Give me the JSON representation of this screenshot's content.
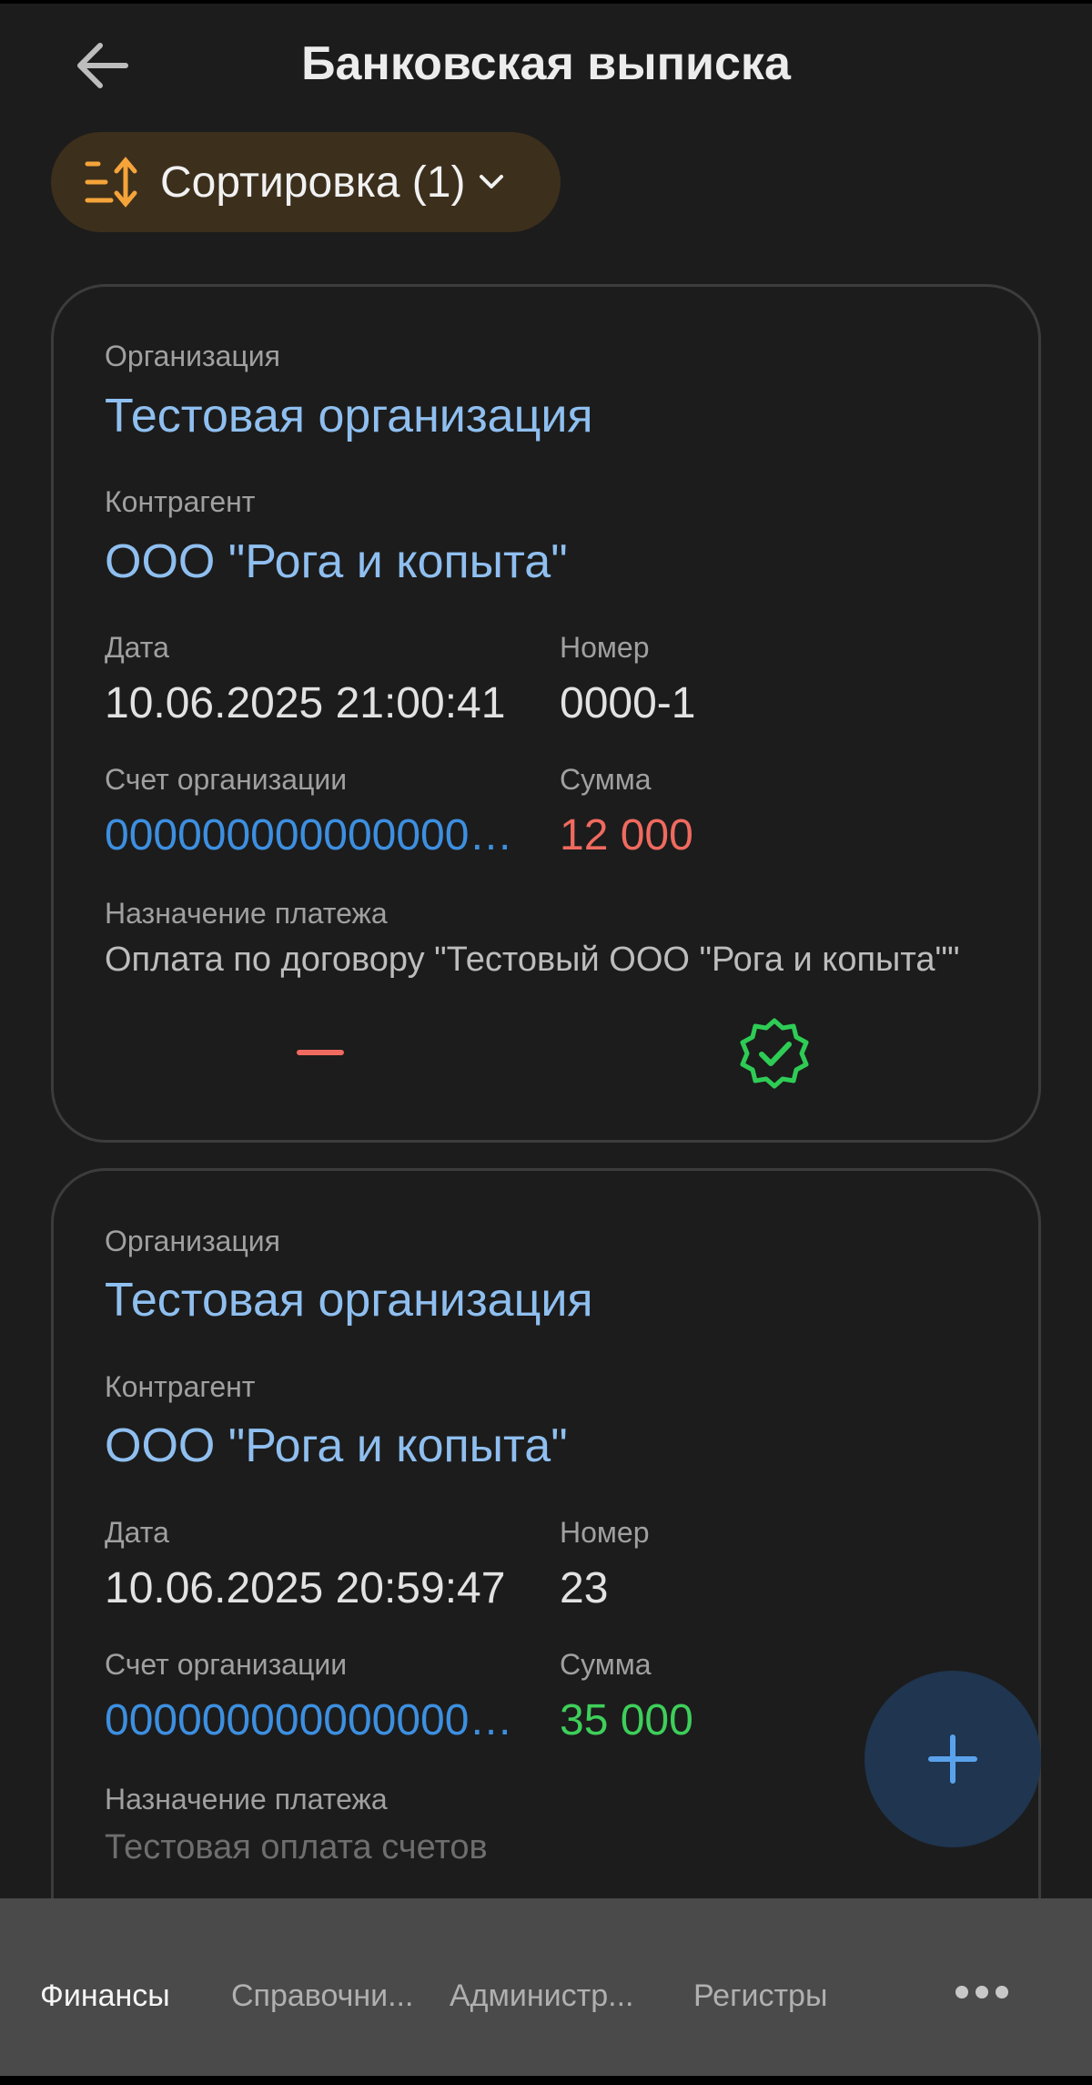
{
  "header": {
    "title": "Банковская выписка"
  },
  "sort": {
    "label": "Сортировка (1)"
  },
  "labels": {
    "organization": "Организация",
    "counterparty": "Контрагент",
    "date": "Дата",
    "number": "Номер",
    "account": "Счет организации",
    "sum": "Сумма",
    "purpose": "Назначение платежа"
  },
  "cards": [
    {
      "organization": "Тестовая организация",
      "counterparty": "ООО \"Рога и копыта\"",
      "date": "10.06.2025 21:00:41",
      "number": "0000-1",
      "account": "00000000000000000000",
      "sum": "12 000",
      "purpose": "Оплата по договору \"Тестовый ООО \"Рога и копыта\"\"",
      "direction": "outgoing",
      "status_icon": "verified-badge-icon"
    },
    {
      "organization": "Тестовая организация",
      "counterparty": "ООО \"Рога и копыта\"",
      "date": "10.06.2025 20:59:47",
      "number": "23",
      "account": "00000000000000000000",
      "sum": "35 000",
      "purpose": "Тестовая оплата счетов",
      "direction": "incoming"
    }
  ],
  "bottom_nav": {
    "items": [
      {
        "label": "Финансы",
        "active": true
      },
      {
        "label": "Справочни..."
      },
      {
        "label": "Администр..."
      },
      {
        "label": "Регистры"
      }
    ],
    "more_icon": "more-dots-icon"
  },
  "colors": {
    "accent_blue": "#3d8fe0",
    "link_blue": "#8fbff0",
    "negative": "#f06a5f",
    "positive": "#3ecf5a",
    "sort_chip": "#3c2f1c",
    "sort_icon": "#f5a43a"
  }
}
